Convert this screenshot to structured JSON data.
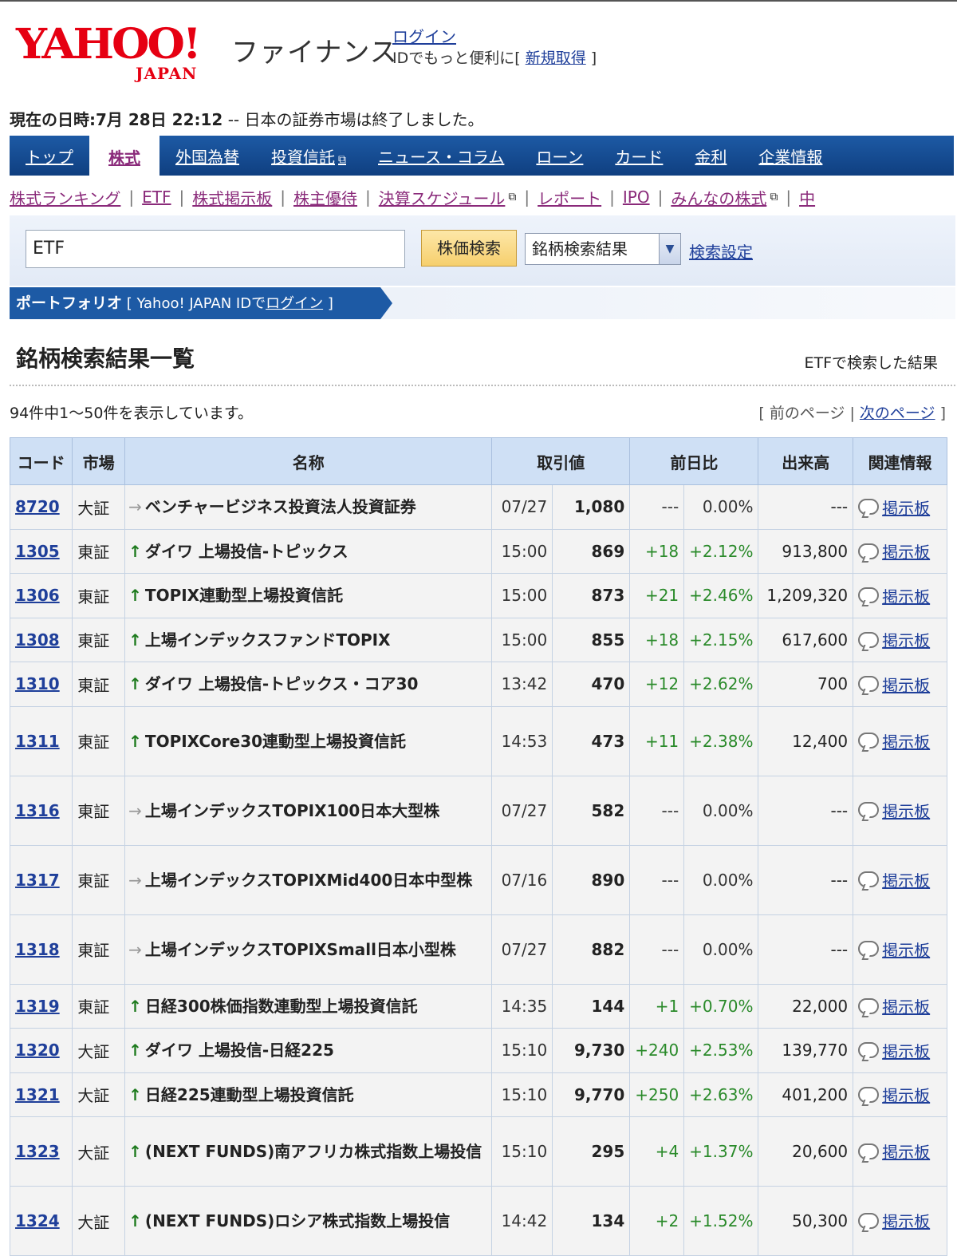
{
  "header": {
    "logo_text": "YAHOO!",
    "logo_sub": "JAPAN",
    "service": "ファイナンス",
    "login_link": "ログイン",
    "id_prefix": "IDでもっと便利に[",
    "id_link": "新規取得",
    "id_suffix": "]"
  },
  "status": {
    "label": "現在の日時:",
    "datetime": "7月 28日 22:12",
    "message": " -- 日本の証券市場は終了しました。"
  },
  "main_nav": [
    {
      "label": "トップ",
      "active": false
    },
    {
      "label": "株式",
      "active": true
    },
    {
      "label": "外国為替",
      "active": false
    },
    {
      "label": "投資信託",
      "active": false,
      "external": true
    },
    {
      "label": "ニュース・コラム",
      "active": false
    },
    {
      "label": "ローン",
      "active": false
    },
    {
      "label": "カード",
      "active": false
    },
    {
      "label": "金利",
      "active": false
    },
    {
      "label": "企業情報",
      "active": false
    }
  ],
  "sub_nav": [
    "株式ランキング",
    "ETF",
    "株式掲示板",
    "株主優待",
    "決算スケジュール",
    "レポート",
    "IPO",
    "みんなの株式",
    "中"
  ],
  "search": {
    "value": "ETF",
    "button": "株価検索",
    "select_value": "銘柄検索結果",
    "settings_link": "検索設定"
  },
  "portfolio": {
    "label": "ポートフォリオ",
    "prefix": "[ Yahoo! JAPAN IDで",
    "link": "ログイン",
    "suffix": "]"
  },
  "results": {
    "title": "銘柄検索結果一覧",
    "subtitle": "ETFで検索した結果",
    "count_text": "94件中1〜50件を表示しています。",
    "prev_page": "前のページ",
    "next_page": "次のページ",
    "columns": [
      "コード",
      "市場",
      "名称",
      "取引値",
      "前日比",
      "出来高",
      "関連情報"
    ],
    "rows": [
      {
        "code": "8720",
        "market": "大証",
        "name": "ベンチャービジネス投資法人投資証券",
        "trend": "flat",
        "time": "07/27",
        "price": "1,080",
        "change": "---",
        "pct": "0.00%",
        "volume": "---",
        "info": "掲示板"
      },
      {
        "code": "1305",
        "market": "東証",
        "name": "ダイワ 上場投信-トピックス",
        "trend": "up",
        "time": "15:00",
        "price": "869",
        "change": "+18",
        "pct": "+2.12%",
        "volume": "913,800",
        "info": "掲示板"
      },
      {
        "code": "1306",
        "market": "東証",
        "name": "TOPIX連動型上場投資信託",
        "trend": "up",
        "time": "15:00",
        "price": "873",
        "change": "+21",
        "pct": "+2.46%",
        "volume": "1,209,320",
        "info": "掲示板"
      },
      {
        "code": "1308",
        "market": "東証",
        "name": "上場インデックスファンドTOPIX",
        "trend": "up",
        "time": "15:00",
        "price": "855",
        "change": "+18",
        "pct": "+2.15%",
        "volume": "617,600",
        "info": "掲示板"
      },
      {
        "code": "1310",
        "market": "東証",
        "name": "ダイワ 上場投信-トピックス・コア30",
        "trend": "up",
        "time": "13:42",
        "price": "470",
        "change": "+12",
        "pct": "+2.62%",
        "volume": "700",
        "info": "掲示板"
      },
      {
        "code": "1311",
        "market": "東証",
        "name": "TOPIXCore30連動型上場投資信託",
        "trend": "up",
        "time": "14:53",
        "price": "473",
        "change": "+11",
        "pct": "+2.38%",
        "volume": "12,400",
        "info": "掲示板"
      },
      {
        "code": "1316",
        "market": "東証",
        "name": "上場インデックスTOPIX100日本大型株",
        "trend": "flat",
        "time": "07/27",
        "price": "582",
        "change": "---",
        "pct": "0.00%",
        "volume": "---",
        "info": "掲示板"
      },
      {
        "code": "1317",
        "market": "東証",
        "name": "上場インデックスTOPIXMid400日本中型株",
        "trend": "flat",
        "time": "07/16",
        "price": "890",
        "change": "---",
        "pct": "0.00%",
        "volume": "---",
        "info": "掲示板"
      },
      {
        "code": "1318",
        "market": "東証",
        "name": "上場インデックスTOPIXSmall日本小型株",
        "trend": "flat",
        "time": "07/27",
        "price": "882",
        "change": "---",
        "pct": "0.00%",
        "volume": "---",
        "info": "掲示板"
      },
      {
        "code": "1319",
        "market": "東証",
        "name": "日経300株価指数連動型上場投資信託",
        "trend": "up",
        "time": "14:35",
        "price": "144",
        "change": "+1",
        "pct": "+0.70%",
        "volume": "22,000",
        "info": "掲示板"
      },
      {
        "code": "1320",
        "market": "大証",
        "name": "ダイワ 上場投信-日経225",
        "trend": "up",
        "time": "15:10",
        "price": "9,730",
        "change": "+240",
        "pct": "+2.53%",
        "volume": "139,770",
        "info": "掲示板"
      },
      {
        "code": "1321",
        "market": "大証",
        "name": "日経225連動型上場投資信託",
        "trend": "up",
        "time": "15:10",
        "price": "9,770",
        "change": "+250",
        "pct": "+2.63%",
        "volume": "401,200",
        "info": "掲示板"
      },
      {
        "code": "1323",
        "market": "大証",
        "name": "(NEXT FUNDS)南アフリカ株式指数上場投信",
        "trend": "up",
        "time": "15:10",
        "price": "295",
        "change": "+4",
        "pct": "+1.37%",
        "volume": "20,600",
        "info": "掲示板"
      },
      {
        "code": "1324",
        "market": "大証",
        "name": "(NEXT FUNDS)ロシア株式指数上場投信",
        "trend": "up",
        "time": "14:42",
        "price": "134",
        "change": "+2",
        "pct": "+1.52%",
        "volume": "50,300",
        "info": "掲示板"
      }
    ]
  },
  "colors": {
    "nav_blue": "#1d5aa5",
    "brand_red": "#e60012",
    "up_green": "#2a8a2a",
    "header_cell": "#cfe0f5"
  }
}
